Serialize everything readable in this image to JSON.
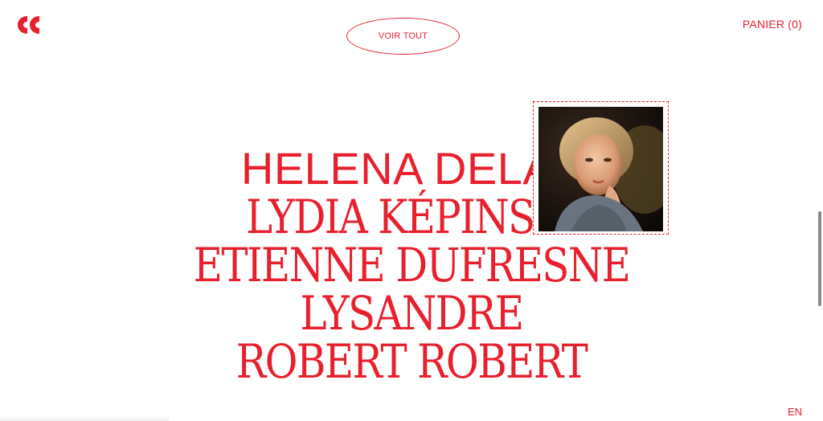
{
  "header": {
    "logo_icon": "double-quote-logo",
    "voir_tout_label": "VOIR TOUT",
    "panier_label": "PANIER (0)"
  },
  "artists": [
    {
      "name": "HELENA DELAND",
      "active": true
    },
    {
      "name": "LYDIA KÉPINSKI",
      "active": false
    },
    {
      "name": "ETIENNE DUFRESNE",
      "active": false
    },
    {
      "name": "LYSANDRE",
      "active": false
    },
    {
      "name": "ROBERT ROBERT",
      "active": false
    }
  ],
  "footer": {
    "language_label": "EN"
  },
  "colors": {
    "accent": "#e8202e",
    "background": "#ffffff"
  }
}
